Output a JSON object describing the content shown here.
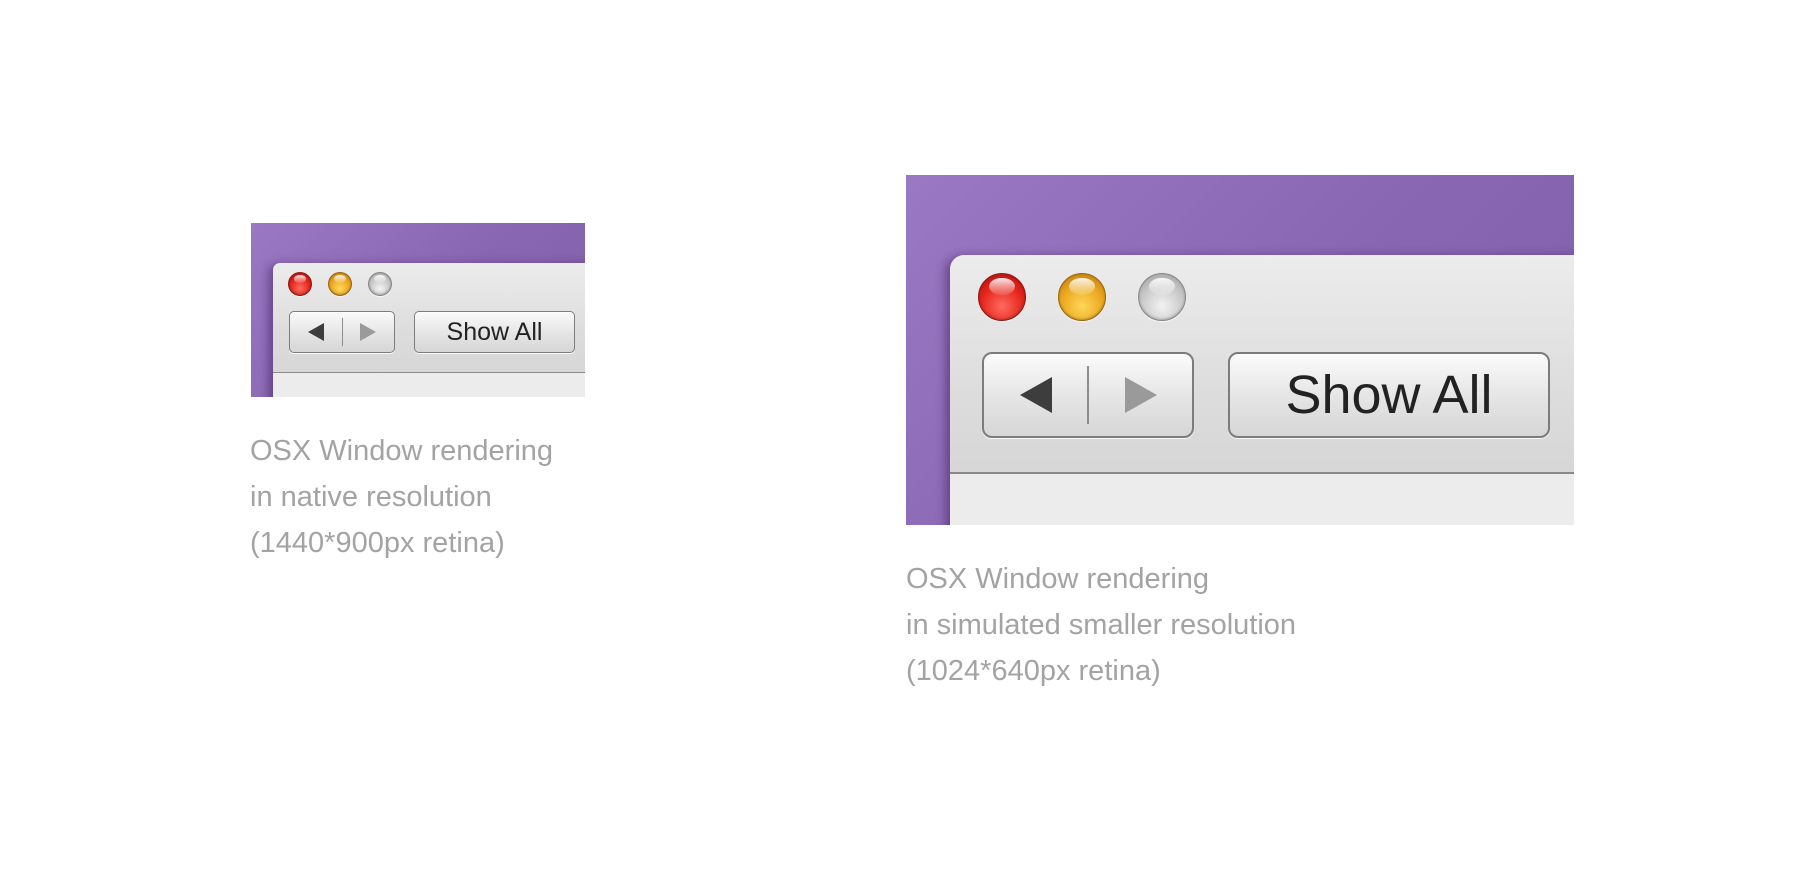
{
  "colors": {
    "wallpaper": "#8f6cb8",
    "caption_text": "#a3a3a3",
    "close": "#e3241b",
    "minimize": "#eaa61d",
    "zoom": "#c7c7c7"
  },
  "native": {
    "show_all_label": "Show All",
    "caption_lines": [
      "OSX Window rendering",
      "in native resolution",
      "(1440*900px retina)"
    ],
    "icons": [
      "close-button-icon",
      "minimize-button-icon",
      "zoom-button-icon",
      "back-arrow-icon",
      "forward-arrow-icon"
    ]
  },
  "simulated": {
    "show_all_label": "Show All",
    "caption_lines": [
      "OSX Window rendering",
      "in simulated smaller resolution",
      "(1024*640px retina)"
    ],
    "icons": [
      "close-button-icon",
      "minimize-button-icon",
      "zoom-button-icon",
      "back-arrow-icon",
      "forward-arrow-icon"
    ]
  }
}
